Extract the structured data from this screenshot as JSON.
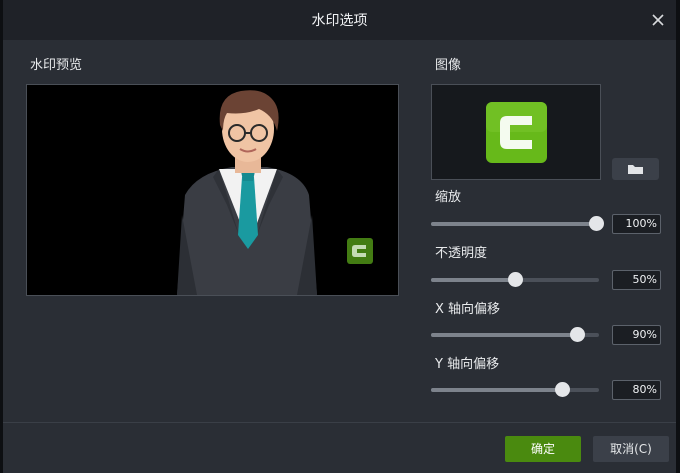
{
  "dialog": {
    "title": "水印选项",
    "preview_label": "水印预览",
    "image_label": "图像",
    "ok_label": "确定",
    "cancel_label": "取消(C)"
  },
  "controls": {
    "scale": {
      "label": "缩放",
      "value": "100%",
      "fraction": 1.0
    },
    "opacity": {
      "label": "不透明度",
      "value": "50%",
      "fraction": 0.5
    },
    "x_offset": {
      "label": "X 轴向偏移",
      "value": "90%",
      "fraction": 0.9
    },
    "y_offset": {
      "label": "Y 轴向偏移",
      "value": "80%",
      "fraction": 0.8
    }
  },
  "colors": {
    "accent": "#4a8a0f",
    "logo_green": "#67b91a",
    "dialog_bg": "#2a2e35"
  },
  "icons": {
    "close": "close-icon",
    "folder": "folder-icon",
    "logo": "camtasia-logo-icon"
  }
}
